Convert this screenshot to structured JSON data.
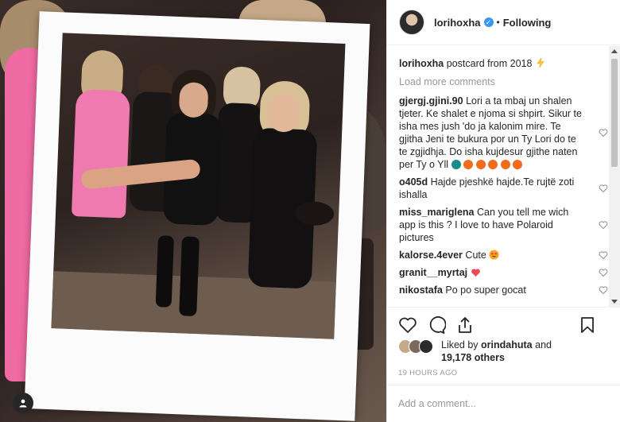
{
  "post": {
    "username": "lorihoxha",
    "follow_status": "Following",
    "separator": "•"
  },
  "caption": {
    "username": "lorihoxha",
    "text": "postcard from 2018",
    "emoji": "lightning-icon"
  },
  "load_more": "Load more comments",
  "comments": [
    {
      "username": "gjergj.gjini.90",
      "text": "Lori a ta mbaj un shalen tjeter. Ke shalet e njoma si shpirt. Sikur te isha mes jush 'do ja kalonim mire. Te gjitha Jeni te bukura por un Ty Lori do te te zgjidhja. Do isha kujdesur gjithe naten per Ty o Yll"
    },
    {
      "username": "o405d",
      "text": "Hajde pjeshkë hajde.Te rujtë zoti ishalla"
    },
    {
      "username": "miss_mariglena",
      "text": "Can you tell me wich app is this ? I love to have Polaroid pictures"
    },
    {
      "username": "kalorse.4ever",
      "text": "Cute"
    },
    {
      "username": "granit__myrtaj",
      "text": ""
    },
    {
      "username": "nikostafa",
      "text": "Po po super gocat"
    }
  ],
  "likes": {
    "prefix": "Liked by",
    "user": "orindahuta",
    "conj": "and",
    "others": "19,178 others"
  },
  "timestamp": "19 HOURS AGO",
  "add_comment": {
    "placeholder": "Add a comment..."
  },
  "colors": {
    "verified": "#3897f0",
    "heart_red": "#ed4956",
    "fire": "#f26b1d",
    "smile": "#f5a623"
  }
}
